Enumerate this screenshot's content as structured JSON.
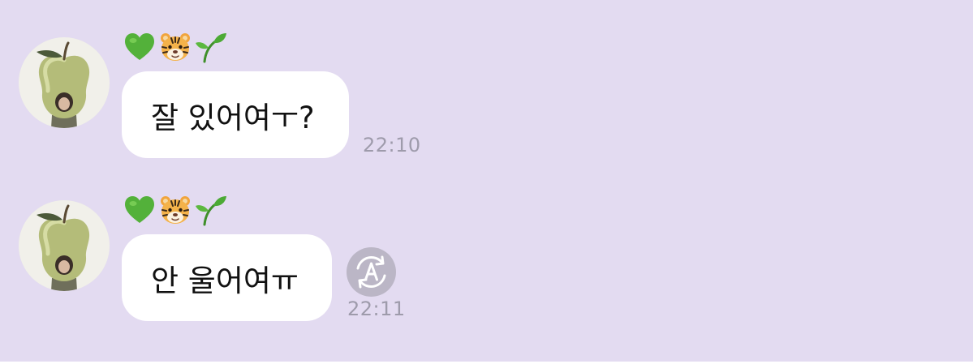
{
  "chat": {
    "background_color": "#e3dbf1",
    "bubble_color": "#ffffff",
    "timestamp_color": "#9e9bab",
    "messages": [
      {
        "sender_badges": [
          "green-heart-emoji",
          "tiger-face-emoji",
          "seedling-emoji"
        ],
        "avatar": "green-apple-profile-photo",
        "text": "잘 있어여ㅜ?",
        "time": "22:10"
      },
      {
        "sender_badges": [
          "green-heart-emoji",
          "tiger-face-emoji",
          "seedling-emoji"
        ],
        "avatar": "green-apple-profile-photo",
        "text": "안 울어여ㅠ",
        "time": "22:11",
        "action_icon": "translate-icon"
      }
    ]
  }
}
